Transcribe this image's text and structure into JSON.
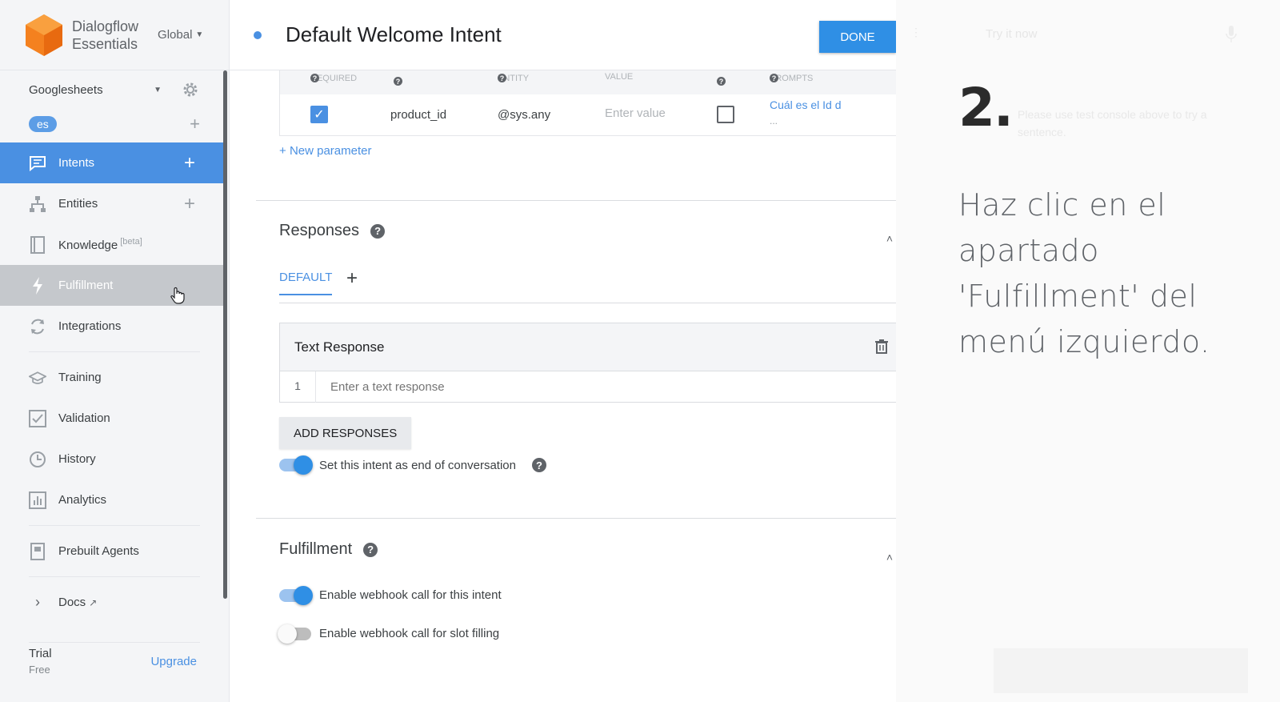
{
  "brand": {
    "name_line1": "Dialogflow",
    "name_line2": "Essentials",
    "region": "Global",
    "logo_color": "#f4811f"
  },
  "agent": {
    "name": "Googlesheets",
    "language": "es"
  },
  "nav": {
    "items": [
      {
        "label": "Intents",
        "icon": "chat-icon",
        "active": true,
        "addable": true
      },
      {
        "label": "Entities",
        "icon": "sitemap-icon",
        "active": false,
        "addable": true
      },
      {
        "label": "Knowledge",
        "icon": "book-icon",
        "badge": "[beta]"
      },
      {
        "label": "Fulfillment",
        "icon": "bolt-icon",
        "hover": true
      },
      {
        "label": "Integrations",
        "icon": "sync-icon"
      },
      {
        "label": "Training",
        "icon": "graduation-cap-icon"
      },
      {
        "label": "Validation",
        "icon": "check-square-icon"
      },
      {
        "label": "History",
        "icon": "clock-icon"
      },
      {
        "label": "Analytics",
        "icon": "bar-chart-icon"
      },
      {
        "label": "Prebuilt Agents",
        "icon": "agent-book-icon"
      },
      {
        "label": "Docs",
        "icon": "chevron-right-icon"
      }
    ]
  },
  "trial": {
    "title": "Trial",
    "plan": "Free",
    "upgrade": "Upgrade"
  },
  "intent": {
    "title": "Default Welcome Intent",
    "done": "DONE"
  },
  "parameters": {
    "headers": [
      "REQUIRED",
      "ENTITY",
      "VALUE",
      "PROMPTS"
    ],
    "row": {
      "required": true,
      "name": "product_id",
      "entity": "@sys.any",
      "value_placeholder": "Enter value",
      "is_list": false,
      "prompt": "Cuál es el Id d",
      "prompt_more": "..."
    },
    "new_param": "New parameter"
  },
  "responses": {
    "title": "Responses",
    "tab": "DEFAULT",
    "card_title": "Text Response",
    "row_number": "1",
    "placeholder": "Enter a text response",
    "add_button": "ADD RESPONSES",
    "end_conversation": "Set this intent as end of conversation"
  },
  "fulfillment": {
    "title": "Fulfillment",
    "webhook": "Enable webhook call for this intent",
    "slot_filling": "Enable webhook call for slot filling"
  },
  "overlay": {
    "step": "2.",
    "line1": "Haz clic en el",
    "line2": "apartado",
    "line3": "'Fulfillment' del",
    "line4": "menú izquierdo.",
    "ghost_try": "Try it now",
    "ghost_hint": "Please use test console above to try a sentence."
  },
  "colors": {
    "accent": "#4a90e2",
    "done": "#2f8fe5"
  }
}
